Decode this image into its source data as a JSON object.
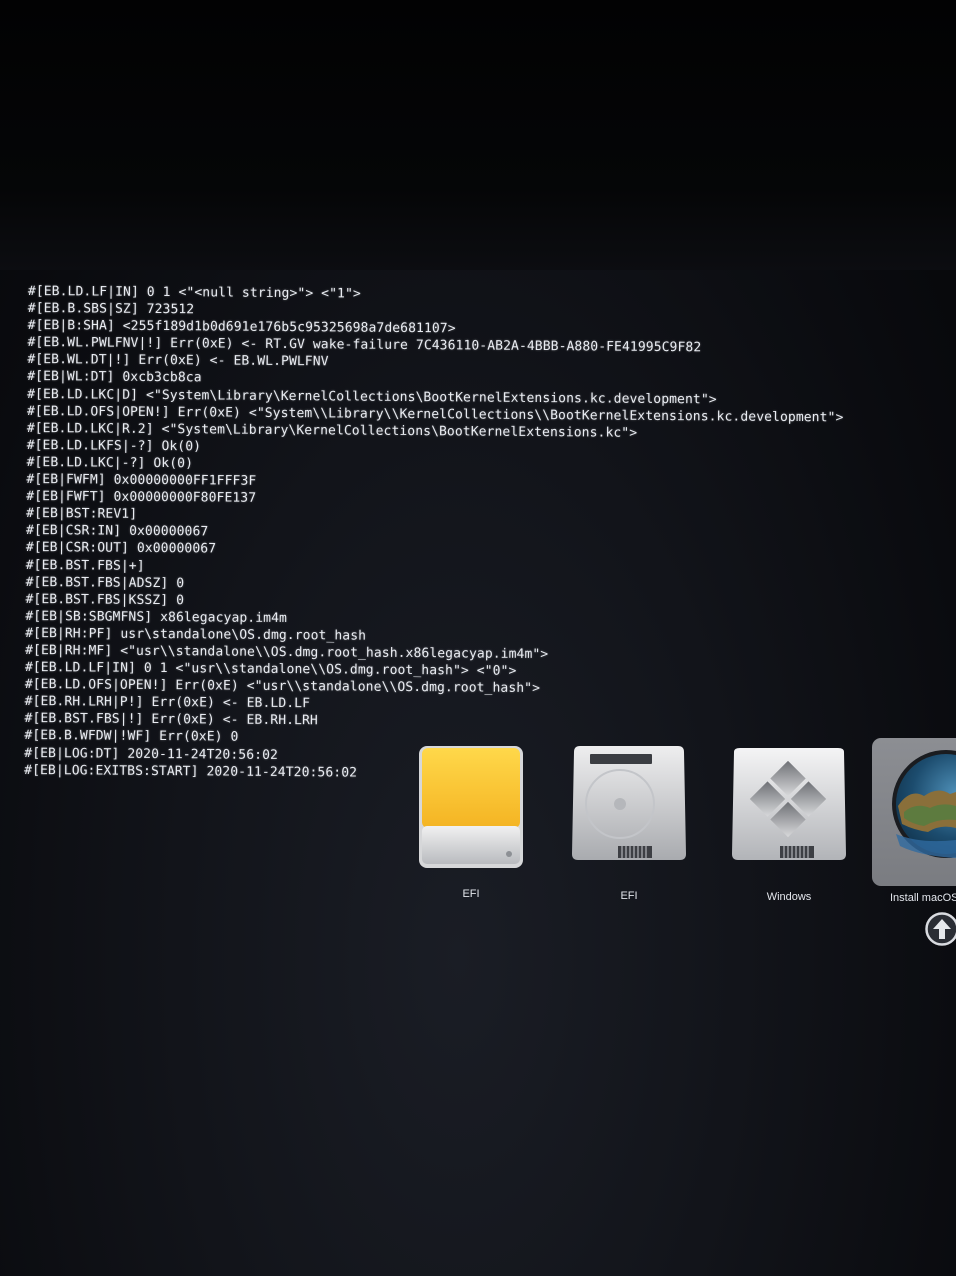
{
  "log_lines": [
    "#[EB.LD.LF|IN] 0 1 <\"<null string>\"> <\"1\">",
    "#[EB.B.SBS|SZ] 723512",
    "#[EB|B:SHA] <255f189d1b0d691e176b5c95325698a7de681107>",
    "#[EB.WL.PWLFNV|!] Err(0xE) <- RT.GV wake-failure 7C436110-AB2A-4BBB-A880-FE41995C9F82",
    "#[EB.WL.DT|!] Err(0xE) <- EB.WL.PWLFNV",
    "#[EB|WL:DT] 0xcb3cb8ca",
    "#[EB.LD.LKC|D] <\"System\\Library\\KernelCollections\\BootKernelExtensions.kc.development\">",
    "#[EB.LD.OFS|OPEN!] Err(0xE) <\"System\\\\Library\\\\KernelCollections\\\\BootKernelExtensions.kc.development\">",
    "#[EB.LD.LKC|R.2] <\"System\\Library\\KernelCollections\\BootKernelExtensions.kc\">",
    "#[EB.LD.LKFS|-?] Ok(0)",
    "#[EB.LD.LKC|-?] Ok(0)",
    "#[EB|FWFM] 0x00000000FF1FFF3F",
    "#[EB|FWFT] 0x00000000F80FE137",
    "#[EB|BST:REV1]",
    "#[EB|CSR:IN] 0x00000067",
    "#[EB|CSR:OUT] 0x00000067",
    "#[EB.BST.FBS|+]",
    "#[EB.BST.FBS|ADSZ] 0",
    "#[EB.BST.FBS|KSSZ] 0",
    "#[EB|SB:SBGMFNS] x86legacyap.im4m",
    "#[EB|RH:PF] usr\\standalone\\OS.dmg.root_hash",
    "#[EB|RH:MF] <\"usr\\\\standalone\\\\OS.dmg.root_hash.x86legacyap.im4m\">",
    "#[EB.LD.LF|IN] 0 1 <\"usr\\\\standalone\\\\OS.dmg.root_hash\"> <\"0\">",
    "#[EB.LD.OFS|OPEN!] Err(0xE) <\"usr\\\\standalone\\\\OS.dmg.root_hash\">",
    "#[EB.RH.LRH|P!] Err(0xE) <- EB.LD.LF",
    "#[EB.BST.FBS|!] Err(0xE) <- EB.RH.LRH",
    "#[EB.B.WFDW|!WF] Err(0xE) 0",
    "#[EB|LOG:DT] 2020-11-24T20:56:02",
    "#[EB|LOG:EXITBS:START] 2020-11-24T20:56:02"
  ],
  "boot_picker": {
    "entries": [
      {
        "label": "EFI",
        "icon": "efi-drive-icon",
        "color": "#f7c230"
      },
      {
        "label": "EFI",
        "icon": "internal-disk-icon"
      },
      {
        "label": "Windows",
        "icon": "windows-disk-icon"
      },
      {
        "label": "Install macOS",
        "icon": "macos-installer-icon",
        "selected": true
      }
    ],
    "action_icon": "arrow-up-circle-icon"
  },
  "colors": {
    "background": "#12141a",
    "log_text": "#e9ecf2",
    "efi_yellow": "#f7c230",
    "selected_frame": "#8c8e93"
  }
}
